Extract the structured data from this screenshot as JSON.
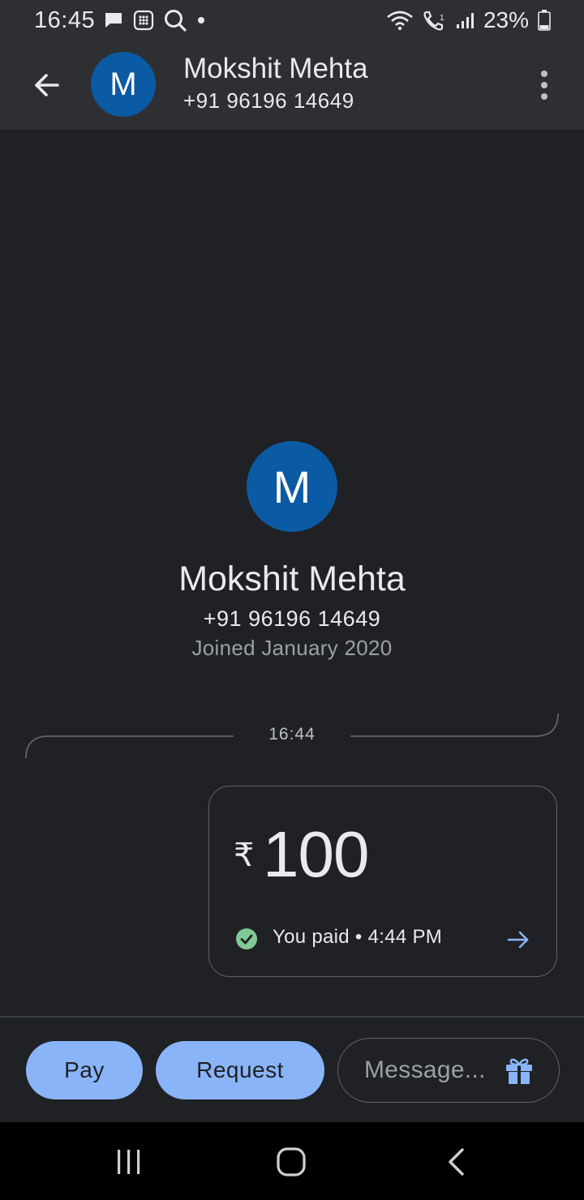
{
  "status_bar": {
    "time": "16:45",
    "battery": "23%",
    "icons": [
      "message-icon",
      "calculator-icon",
      "search-icon",
      "dot-icon",
      "wifi-icon",
      "wifi-call-icon",
      "signal-icon",
      "battery-icon"
    ]
  },
  "header": {
    "avatar_letter": "M",
    "name": "Mokshit Mehta",
    "phone": "+91 96196 14649"
  },
  "profile": {
    "avatar_letter": "M",
    "name": "Mokshit Mehta",
    "phone": "+91 96196 14649",
    "joined": "Joined January 2020"
  },
  "timeline": {
    "time": "16:44"
  },
  "payment": {
    "currency": "₹",
    "amount": "100",
    "status": "You paid • 4:44 PM"
  },
  "bottom_bar": {
    "pay_label": "Pay",
    "request_label": "Request",
    "message_placeholder": "Message..."
  },
  "colors": {
    "background": "#202124",
    "bar": "#2e2f32",
    "avatar": "#0b5aa4",
    "accent": "#8ab4f8",
    "success": "#81c995"
  }
}
